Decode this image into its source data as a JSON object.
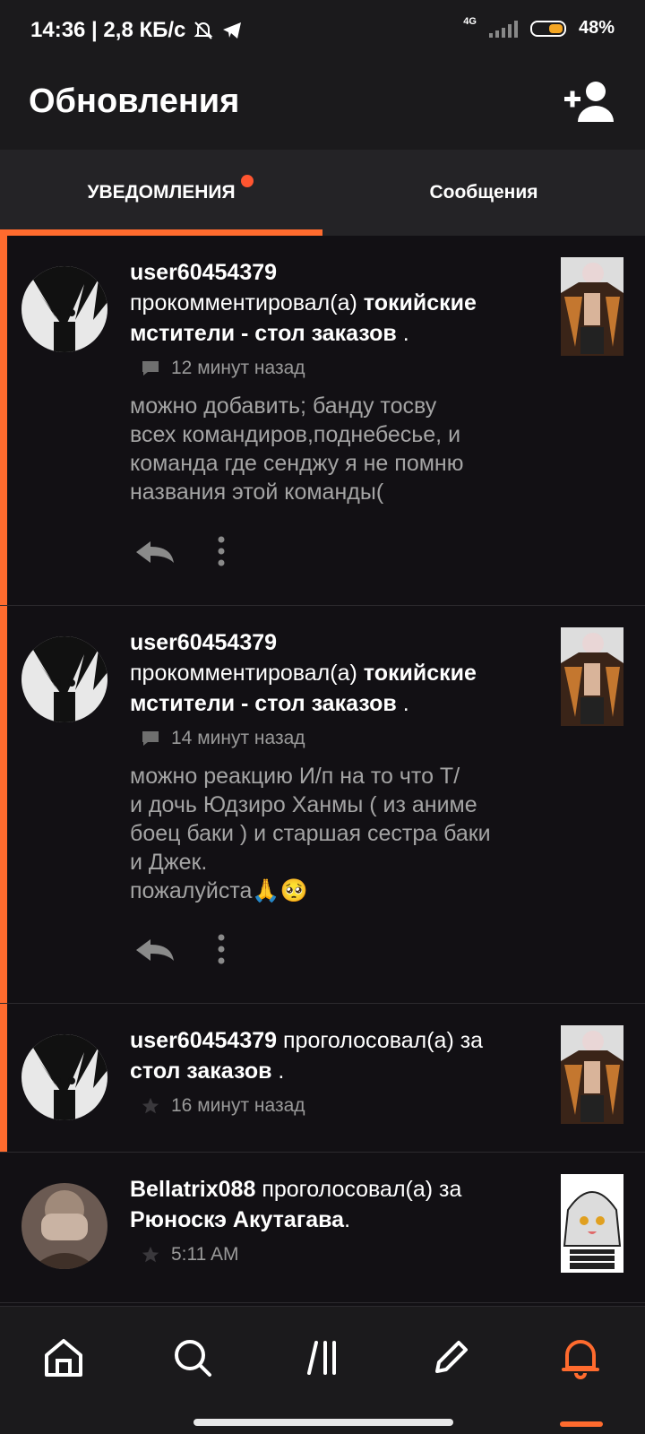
{
  "status_bar": {
    "time_speed": "14:36 | 2,8 КБ/с",
    "network": "4G",
    "battery": "48%",
    "battery_level": 0.48
  },
  "header": {
    "title": "Обновления"
  },
  "tabs": [
    {
      "label": "УВЕДОМЛЕНИЯ",
      "active": true,
      "has_badge": true
    },
    {
      "label": "Сообщения",
      "active": false,
      "has_badge": false
    }
  ],
  "notifications": [
    {
      "user": "user60454379",
      "action": "прокомментировал(а)",
      "target": "токийские мстители - стол заказов",
      "suffix": " .",
      "meta_icon": "comment-icon",
      "time": "12 минут назад",
      "comment": [
        "можно добавить; банду тосву",
        "всех командиров,поднебесье, и",
        "команда где сенджу я не помню",
        "названия этой команды("
      ],
      "unread": true
    },
    {
      "user": "user60454379",
      "action": "прокомментировал(а)",
      "target": "токийские мстители - стол заказов",
      "suffix": " .",
      "meta_icon": "comment-icon",
      "time": "14 минут назад",
      "comment": [
        "можно реакцию И/п на то что Т/",
        "и дочь Юдзиро Ханмы ( из аниме",
        "боец баки ) и старшая сестра баки",
        "и Джек.",
        "пожалуйста🙏🥺"
      ],
      "unread": true
    },
    {
      "user": "user60454379",
      "action": "проголосовал(а) за",
      "target": "стол заказов",
      "suffix": " .",
      "meta_icon": "star-icon",
      "time": "16 минут назад",
      "unread": true
    },
    {
      "user": "Bellatrix088",
      "action": "проголосовал(а) за",
      "target": "Рюноскэ Акутагава",
      "suffix": ".",
      "meta_icon": "star-icon",
      "time": "5:11 AM",
      "unread": false
    }
  ],
  "bottom_nav": [
    {
      "icon": "home-icon"
    },
    {
      "icon": "search-icon"
    },
    {
      "icon": "library-icon"
    },
    {
      "icon": "pencil-icon"
    },
    {
      "icon": "bell-icon",
      "active": true
    }
  ],
  "colors": {
    "accent": "#ff6b2e",
    "background": "#121014",
    "header": "#1b1a1c",
    "muted_text": "#a4a4a4"
  }
}
